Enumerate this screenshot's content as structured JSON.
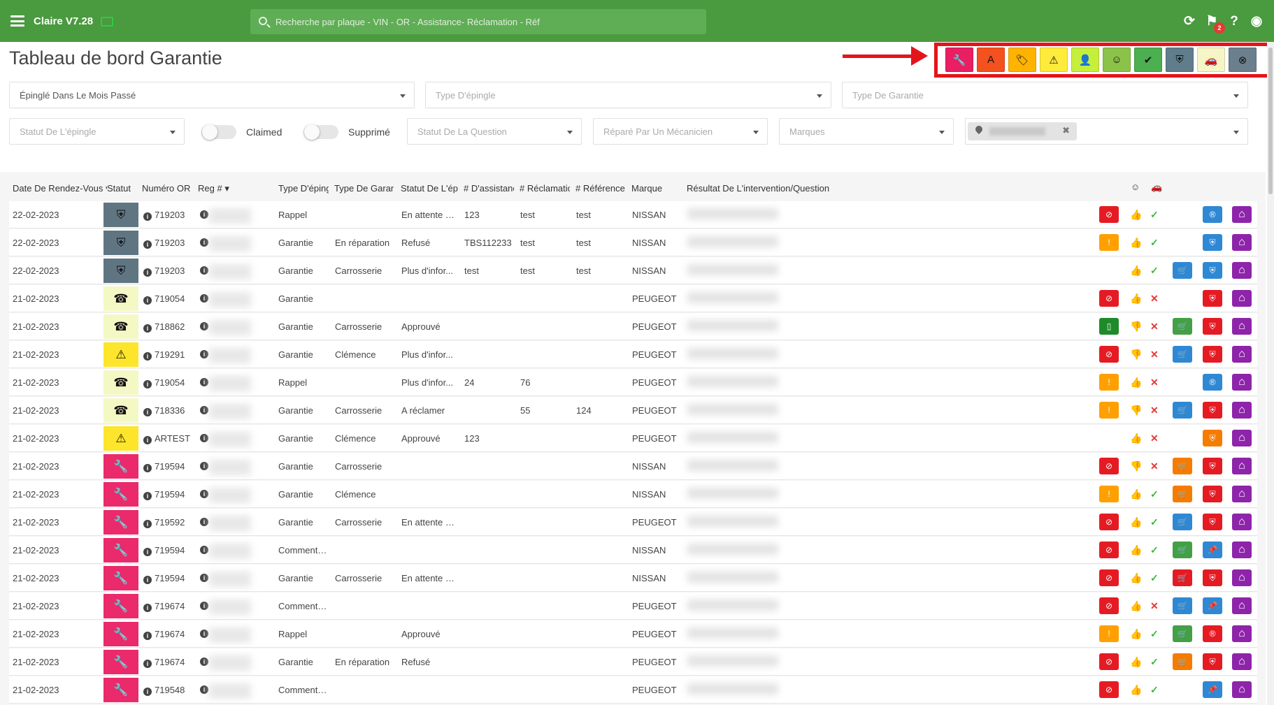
{
  "app": {
    "title": "Claire V7.28",
    "notification_count": "2"
  },
  "search": {
    "placeholder": "Recherche par plaque - VIN - OR - Assistance- Réclamation - Réf"
  },
  "page": {
    "title": "Tableau de bord Garantie"
  },
  "status_filters": [
    {
      "name": "wrench",
      "color": "#e91e63",
      "glyph": "🔧"
    },
    {
      "name": "letter-a",
      "color": "#f4511e",
      "glyph": "A"
    },
    {
      "name": "tag",
      "color": "#ffb300",
      "glyph": "🏷"
    },
    {
      "name": "warning",
      "color": "#ffeb3b",
      "glyph": "⚠"
    },
    {
      "name": "user-check",
      "color": "#c6ef3c",
      "glyph": "👤"
    },
    {
      "name": "smile",
      "color": "#8bc34a",
      "glyph": "☺"
    },
    {
      "name": "double-check",
      "color": "#4caf50",
      "glyph": "✔"
    },
    {
      "name": "shield",
      "color": "#607d8b",
      "glyph": "⛨"
    },
    {
      "name": "car",
      "color": "#f5f5c6",
      "glyph": "🚗"
    },
    {
      "name": "x-circle",
      "color": "#6c7f8d",
      "glyph": "⊗"
    }
  ],
  "filters": {
    "pinned": "Épinglé Dans Le Mois Passé",
    "pin_type": "Type D'épingle",
    "warranty_type": "Type De Garantie",
    "pin_status": "Statut De L'épingle",
    "claimed": "Claimed",
    "deleted": "Supprimé",
    "question_status": "Statut De La Question",
    "repaired_by": "Réparé Par Un Mécanicien",
    "brands": "Marques"
  },
  "columns": {
    "date": "Date De Rendez-Vous",
    "status": "Statut",
    "or_number": "Numéro OR",
    "reg": "Reg #",
    "pin_type": "Type D'épingle",
    "warranty_type": "Type De Garantie",
    "pin_status": "Statut De L'épingle",
    "assistance": "# D'assistance",
    "claim": "# Réclamation",
    "reference": "# Référence",
    "brand": "Marque",
    "result": "Résultat De L'intervention/Question"
  },
  "colors": {
    "shield_status": "#5f7582",
    "phone_status": "#f4f8c4",
    "warning_status": "#fde52b",
    "wrench_status": "#ea2a6b",
    "red": "#e51b23",
    "orange": "#ffa000",
    "green_doc": "#1f8a2a",
    "blue": "#2f88d4",
    "cart_orange": "#f57c00",
    "cart_green": "#43a047",
    "purple": "#8e24aa",
    "thumb_green": "#3db53d",
    "thumb_red": "#e53935"
  },
  "rows": [
    {
      "date": "22-02-2023",
      "status": "shield",
      "or": "719203",
      "pin_type": "Rappel",
      "warranty_type": "",
      "pin_status": "En attente d'...",
      "assistance": "123",
      "claim": "test",
      "reference": "test",
      "brand": "NISSAN",
      "first": "red-ban",
      "thumb": "up",
      "check": "check",
      "cart": "",
      "shield": "blue-r"
    },
    {
      "date": "22-02-2023",
      "status": "shield",
      "or": "719203",
      "pin_type": "Garantie",
      "warranty_type": "En réparation",
      "pin_status": "Refusé",
      "assistance": "TBS112233",
      "claim": "test",
      "reference": "test",
      "brand": "NISSAN",
      "first": "orange-excl",
      "thumb": "up",
      "check": "check",
      "cart": "",
      "shield": "blue-shield"
    },
    {
      "date": "22-02-2023",
      "status": "shield",
      "or": "719203",
      "pin_type": "Garantie",
      "warranty_type": "Carrosserie",
      "pin_status": "Plus d'infor...",
      "assistance": "test",
      "claim": "test",
      "reference": "test",
      "brand": "NISSAN",
      "first": "",
      "thumb": "up",
      "check": "check",
      "cart": "blue",
      "shield": "blue-shield"
    },
    {
      "date": "21-02-2023",
      "status": "phone",
      "or": "719054",
      "pin_type": "Garantie",
      "warranty_type": "",
      "pin_status": "",
      "assistance": "",
      "claim": "",
      "reference": "",
      "brand": "PEUGEOT",
      "first": "red-ban",
      "thumb": "up",
      "check": "x",
      "cart": "",
      "shield": "red-shield"
    },
    {
      "date": "21-02-2023",
      "status": "phone",
      "or": "718862",
      "pin_type": "Garantie",
      "warranty_type": "Carrosserie",
      "pin_status": "Approuvé",
      "assistance": "",
      "claim": "",
      "reference": "",
      "brand": "PEUGEOT",
      "first": "green-doc",
      "thumb": "down",
      "check": "x",
      "cart": "green",
      "shield": "red-shield"
    },
    {
      "date": "21-02-2023",
      "status": "warning",
      "or": "719291",
      "pin_type": "Garantie",
      "warranty_type": "Clémence",
      "pin_status": "Plus d'infor...",
      "assistance": "",
      "claim": "",
      "reference": "",
      "brand": "PEUGEOT",
      "first": "red-ban",
      "thumb": "down",
      "check": "x",
      "cart": "blue",
      "shield": "red-shield"
    },
    {
      "date": "21-02-2023",
      "status": "phone",
      "or": "719054",
      "pin_type": "Rappel",
      "warranty_type": "",
      "pin_status": "Plus d'infor...",
      "assistance": "24",
      "claim": "76",
      "reference": "",
      "brand": "PEUGEOT",
      "first": "orange-excl",
      "thumb": "up",
      "check": "x",
      "cart": "",
      "shield": "blue-r"
    },
    {
      "date": "21-02-2023",
      "status": "phone",
      "or": "718336",
      "pin_type": "Garantie",
      "warranty_type": "Carrosserie",
      "pin_status": "A réclamer",
      "assistance": "",
      "claim": "55",
      "reference": "124",
      "brand": "PEUGEOT",
      "first": "orange-excl",
      "thumb": "down",
      "check": "x",
      "cart": "blue",
      "shield": "red-shield"
    },
    {
      "date": "21-02-2023",
      "status": "warning",
      "or": "ARTEST",
      "pin_type": "Garantie",
      "warranty_type": "Clémence",
      "pin_status": "Approuvé",
      "assistance": "123",
      "claim": "",
      "reference": "",
      "brand": "PEUGEOT",
      "first": "",
      "thumb": "up",
      "check": "x",
      "cart": "",
      "shield": "orange-shield"
    },
    {
      "date": "21-02-2023",
      "status": "wrench",
      "or": "719594",
      "pin_type": "Garantie",
      "warranty_type": "Carrosserie",
      "pin_status": "",
      "assistance": "",
      "claim": "",
      "reference": "",
      "brand": "NISSAN",
      "first": "red-ban",
      "thumb": "down",
      "check": "x",
      "cart": "orange",
      "shield": "red-shield"
    },
    {
      "date": "21-02-2023",
      "status": "wrench",
      "or": "719594",
      "pin_type": "Garantie",
      "warranty_type": "Clémence",
      "pin_status": "",
      "assistance": "",
      "claim": "",
      "reference": "",
      "brand": "NISSAN",
      "first": "orange-excl",
      "thumb": "up",
      "check": "check",
      "cart": "orange",
      "shield": "red-shield"
    },
    {
      "date": "21-02-2023",
      "status": "wrench",
      "or": "719592",
      "pin_type": "Garantie",
      "warranty_type": "Carrosserie",
      "pin_status": "En attente d'...",
      "assistance": "",
      "claim": "",
      "reference": "",
      "brand": "PEUGEOT",
      "first": "red-ban",
      "thumb": "up",
      "check": "check",
      "cart": "blue",
      "shield": "red-shield"
    },
    {
      "date": "21-02-2023",
      "status": "wrench",
      "or": "719594",
      "pin_type": "Commenta...",
      "warranty_type": "",
      "pin_status": "",
      "assistance": "",
      "claim": "",
      "reference": "",
      "brand": "NISSAN",
      "first": "red-ban",
      "thumb": "up",
      "check": "check",
      "cart": "green",
      "shield": "blue-pin"
    },
    {
      "date": "21-02-2023",
      "status": "wrench",
      "or": "719594",
      "pin_type": "Garantie",
      "warranty_type": "Carrosserie",
      "pin_status": "En attente d'...",
      "assistance": "",
      "claim": "",
      "reference": "",
      "brand": "NISSAN",
      "first": "red-ban",
      "thumb": "up",
      "check": "check",
      "cart": "red",
      "shield": "red-shield"
    },
    {
      "date": "21-02-2023",
      "status": "wrench",
      "or": "719674",
      "pin_type": "Commenta...",
      "warranty_type": "",
      "pin_status": "",
      "assistance": "",
      "claim": "",
      "reference": "",
      "brand": "PEUGEOT",
      "first": "red-ban",
      "thumb": "up",
      "check": "x",
      "cart": "blue",
      "shield": "blue-pin"
    },
    {
      "date": "21-02-2023",
      "status": "wrench",
      "or": "719674",
      "pin_type": "Rappel",
      "warranty_type": "",
      "pin_status": "Approuvé",
      "assistance": "",
      "claim": "",
      "reference": "",
      "brand": "PEUGEOT",
      "first": "orange-excl",
      "thumb": "up",
      "check": "check",
      "cart": "green",
      "shield": "red-r"
    },
    {
      "date": "21-02-2023",
      "status": "wrench",
      "or": "719674",
      "pin_type": "Garantie",
      "warranty_type": "En réparation",
      "pin_status": "Refusé",
      "assistance": "",
      "claim": "",
      "reference": "",
      "brand": "PEUGEOT",
      "first": "red-ban",
      "thumb": "up",
      "check": "check",
      "cart": "orange",
      "shield": "red-shield"
    },
    {
      "date": "21-02-2023",
      "status": "wrench",
      "or": "719548",
      "pin_type": "Commenta...",
      "warranty_type": "",
      "pin_status": "",
      "assistance": "",
      "claim": "",
      "reference": "",
      "brand": "PEUGEOT",
      "first": "red-ban",
      "thumb": "up",
      "check": "check",
      "cart": "",
      "shield": "blue-pin"
    }
  ]
}
